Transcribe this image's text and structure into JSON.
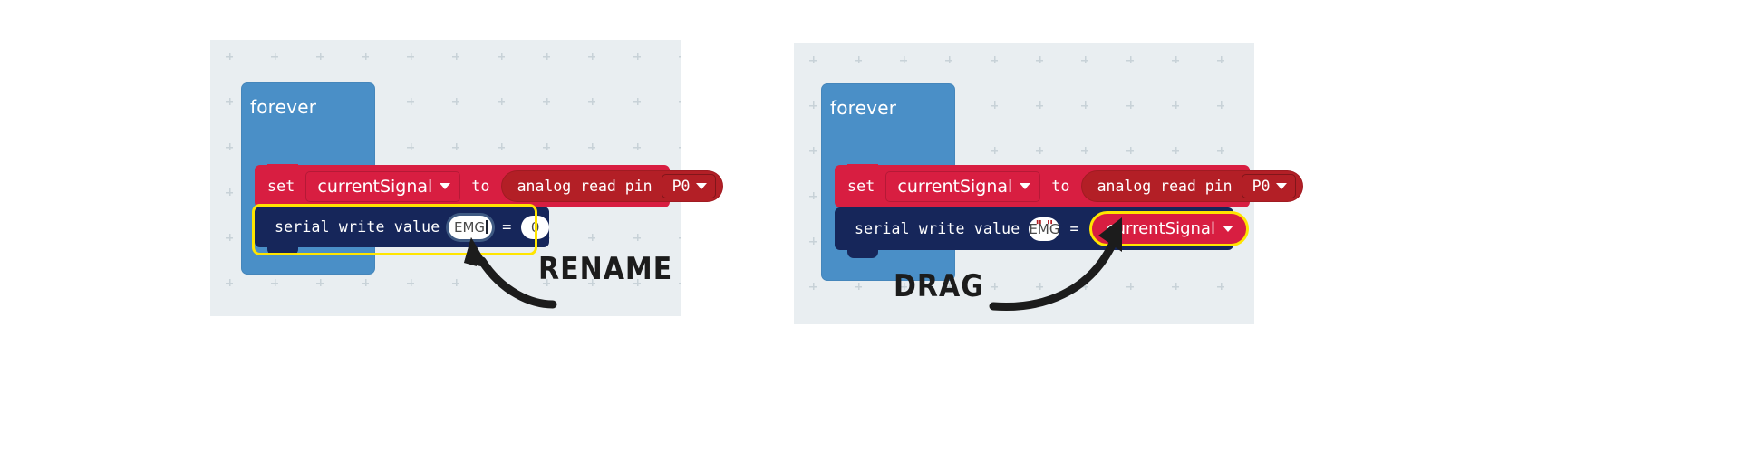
{
  "meta": {
    "colors": {
      "canvas_bg": "#e9eef1",
      "loop_blue": "#4a8fc7",
      "variables_red": "#d81e41",
      "pins_dark_red": "#b31f26",
      "serial_navy": "#16265a",
      "highlight_yellow": "#ffe500",
      "page_bg": "#ffffff"
    }
  },
  "panels": [
    {
      "id": "panel-rename",
      "blocks": {
        "forever_label": "forever",
        "set_row": {
          "keyword": "set",
          "variable": "currentSignal",
          "connector": "to",
          "reporter": {
            "label": "analog read pin",
            "pin": "P0"
          }
        },
        "serial_row": {
          "label": "serial write value",
          "name_field": "EMG",
          "equals": "=",
          "value_field": "0"
        }
      },
      "annotation": {
        "label": "RENAME",
        "arrow": "curved-arrow-up-left"
      }
    },
    {
      "id": "panel-drag",
      "blocks": {
        "forever_label": "forever",
        "set_row": {
          "keyword": "set",
          "variable": "currentSignal",
          "connector": "to",
          "reporter": {
            "label": "analog read pin",
            "pin": "P0"
          }
        },
        "serial_row": {
          "label": "serial write value",
          "name_field": "EMG",
          "quote_open": "\"",
          "quote_close": "\"",
          "equals": "=",
          "value_variable": "currentSignal"
        }
      },
      "annotation": {
        "label": "DRAG",
        "arrow": "curved-arrow-up-right"
      }
    }
  ]
}
